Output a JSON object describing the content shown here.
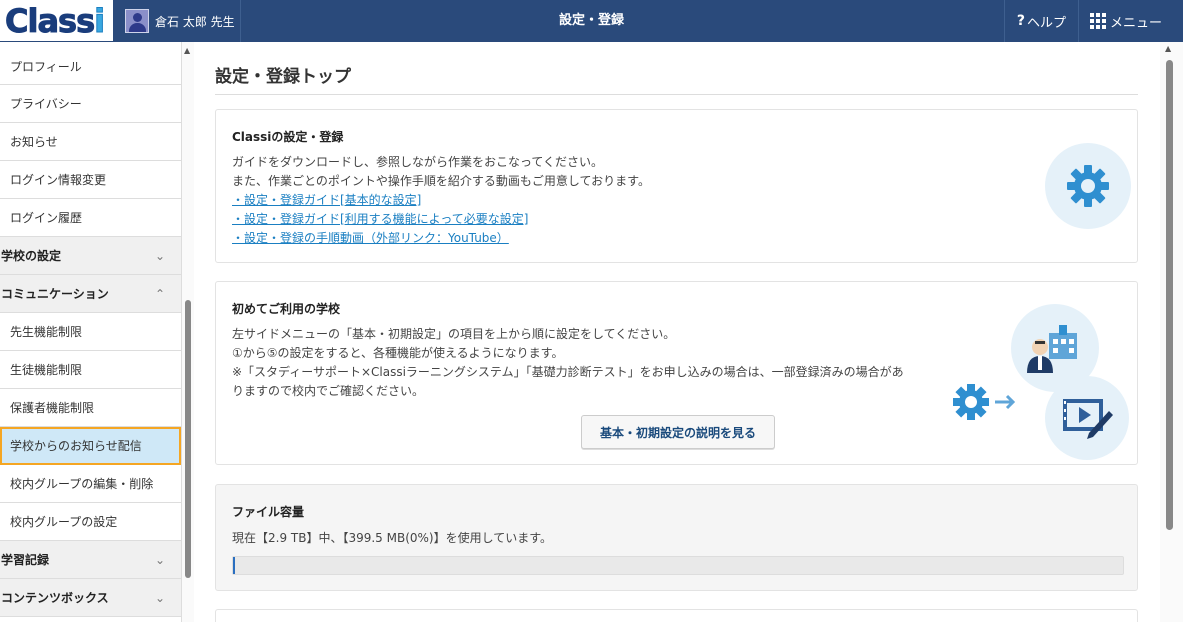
{
  "header": {
    "logo": "Classi",
    "user_name": "倉石 太郎 先生",
    "page_title": "設定・登録",
    "help_label": "ヘルプ",
    "menu_label": "メニュー"
  },
  "sidebar": {
    "items": [
      {
        "label": "プロフィール",
        "type": "item"
      },
      {
        "label": "プライバシー",
        "type": "item"
      },
      {
        "label": "お知らせ",
        "type": "item"
      },
      {
        "label": "ログイン情報変更",
        "type": "item"
      },
      {
        "label": "ログイン履歴",
        "type": "item"
      },
      {
        "label": "学校の設定",
        "type": "section",
        "chevron": "⌄"
      },
      {
        "label": "コミュニケーション",
        "type": "section",
        "chevron": "⌃"
      },
      {
        "label": "先生機能制限",
        "type": "item"
      },
      {
        "label": "生徒機能制限",
        "type": "item"
      },
      {
        "label": "保護者機能制限",
        "type": "item"
      },
      {
        "label": "学校からのお知らせ配信",
        "type": "item",
        "active": true
      },
      {
        "label": "校内グループの編集・削除",
        "type": "item"
      },
      {
        "label": "校内グループの設定",
        "type": "item"
      },
      {
        "label": "学習記録",
        "type": "section",
        "chevron": "⌄"
      },
      {
        "label": "コンテンツボックス",
        "type": "section",
        "chevron": "⌄"
      }
    ]
  },
  "main": {
    "title": "設定・登録トップ",
    "classi_settings": {
      "heading": "Classiの設定・登録",
      "line1": "ガイドをダウンロードし、参照しながら作業をおこなってください。",
      "line2": "また、作業ごとのポイントや操作手順を紹介する動画もご用意しております。",
      "link1": "・設定・登録ガイド[基本的な設定]",
      "link2": "・設定・登録ガイド[利用する機能によって必要な設定]",
      "link3": "・設定・登録の手順動画（外部リンク：YouTube）"
    },
    "first_use": {
      "heading": "初めてご利用の学校",
      "line1": "左サイドメニューの「基本・初期設定」の項目を上から順に設定をしてください。",
      "line2": "①から⑤の設定をすると、各種機能が使えるようになります。",
      "line3": "※「スタディーサポート×Classiラーニングシステム」「基礎力診断テスト」をお申し込みの場合は、一部登録済みの場合があ",
      "line4": "りますので校内でご確認ください。",
      "button": "基本・初期設定の説明を見る"
    },
    "file_capacity": {
      "heading": "ファイル容量",
      "usage_text": "現在【2.9 TB】中、【399.5 MB(0%)】を使用しています。",
      "usage_fraction": 0.002
    }
  },
  "colors": {
    "header_bg": "#2a4a7b",
    "link": "#1a7fc2",
    "active_bg": "#cfe8f7",
    "active_border": "#f5a623"
  }
}
